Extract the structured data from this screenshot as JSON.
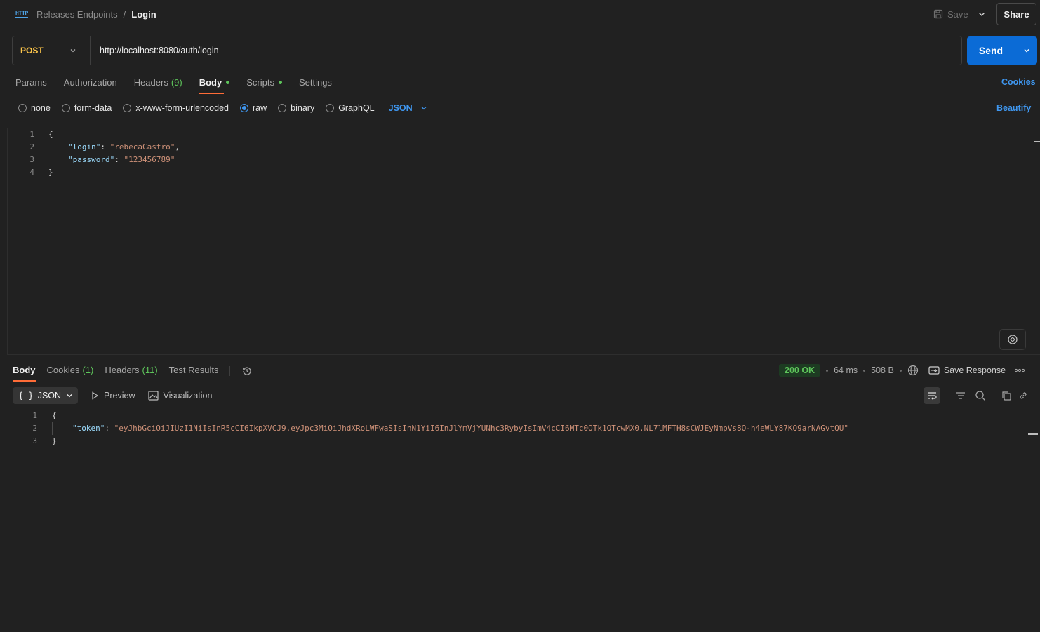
{
  "breadcrumb": {
    "parent": "Releases Endpoints",
    "separator": "/",
    "current": "Login"
  },
  "header": {
    "save_label": "Save",
    "share_label": "Share"
  },
  "request": {
    "method": "POST",
    "url": "http://localhost:8080/auth/login",
    "send_label": "Send",
    "tabs": [
      {
        "label": "Params"
      },
      {
        "label": "Authorization"
      },
      {
        "label": "Headers",
        "count": "(9)"
      },
      {
        "label": "Body",
        "active": true,
        "dot": true
      },
      {
        "label": "Scripts",
        "dot": true
      },
      {
        "label": "Settings"
      }
    ],
    "cookies_label": "Cookies",
    "body_types": [
      "none",
      "form-data",
      "x-www-form-urlencoded",
      "raw",
      "binary",
      "GraphQL"
    ],
    "selected_body_type": "raw",
    "format": "JSON",
    "beautify_label": "Beautify",
    "body_lines": [
      {
        "n": "1",
        "text": "{"
      },
      {
        "n": "2",
        "key": "\"login\"",
        "value": "\"rebecaCastro\"",
        "trail": ","
      },
      {
        "n": "3",
        "key": "\"password\"",
        "value": "\"123456789\"",
        "trail": ""
      },
      {
        "n": "4",
        "text": "}"
      }
    ]
  },
  "response": {
    "tabs": [
      {
        "label": "Body",
        "active": true
      },
      {
        "label": "Cookies",
        "count": "(1)"
      },
      {
        "label": "Headers",
        "count": "(11)"
      },
      {
        "label": "Test Results"
      }
    ],
    "status": "200 OK",
    "time": "64 ms",
    "size": "508 B",
    "save_response_label": "Save Response",
    "view_format": "JSON",
    "view_braces": "{ }",
    "preview_label": "Preview",
    "visualization_label": "Visualization",
    "body_lines": [
      {
        "n": "1",
        "text": "{"
      },
      {
        "n": "2",
        "key": "\"token\"",
        "value": "\"eyJhbGciOiJIUzI1NiIsInR5cCI6IkpXVCJ9.eyJpc3MiOiJhdXRoLWFwaSIsInN1YiI6InJlYmVjYUNhc3RybyIsImV4cCI6MTc0OTk1OTcwMX0.NL7lMFTH8sCWJEyNmpVs8O-h4eWLY87KQ9arNAGvtQU\"",
        "trail": ""
      },
      {
        "n": "3",
        "text": "}"
      }
    ]
  },
  "colors": {
    "accent": "#ff6c37",
    "primary": "#0b6bd6",
    "link": "#3f97f0",
    "method": "#ffc74a",
    "success": "#5ec55b"
  }
}
